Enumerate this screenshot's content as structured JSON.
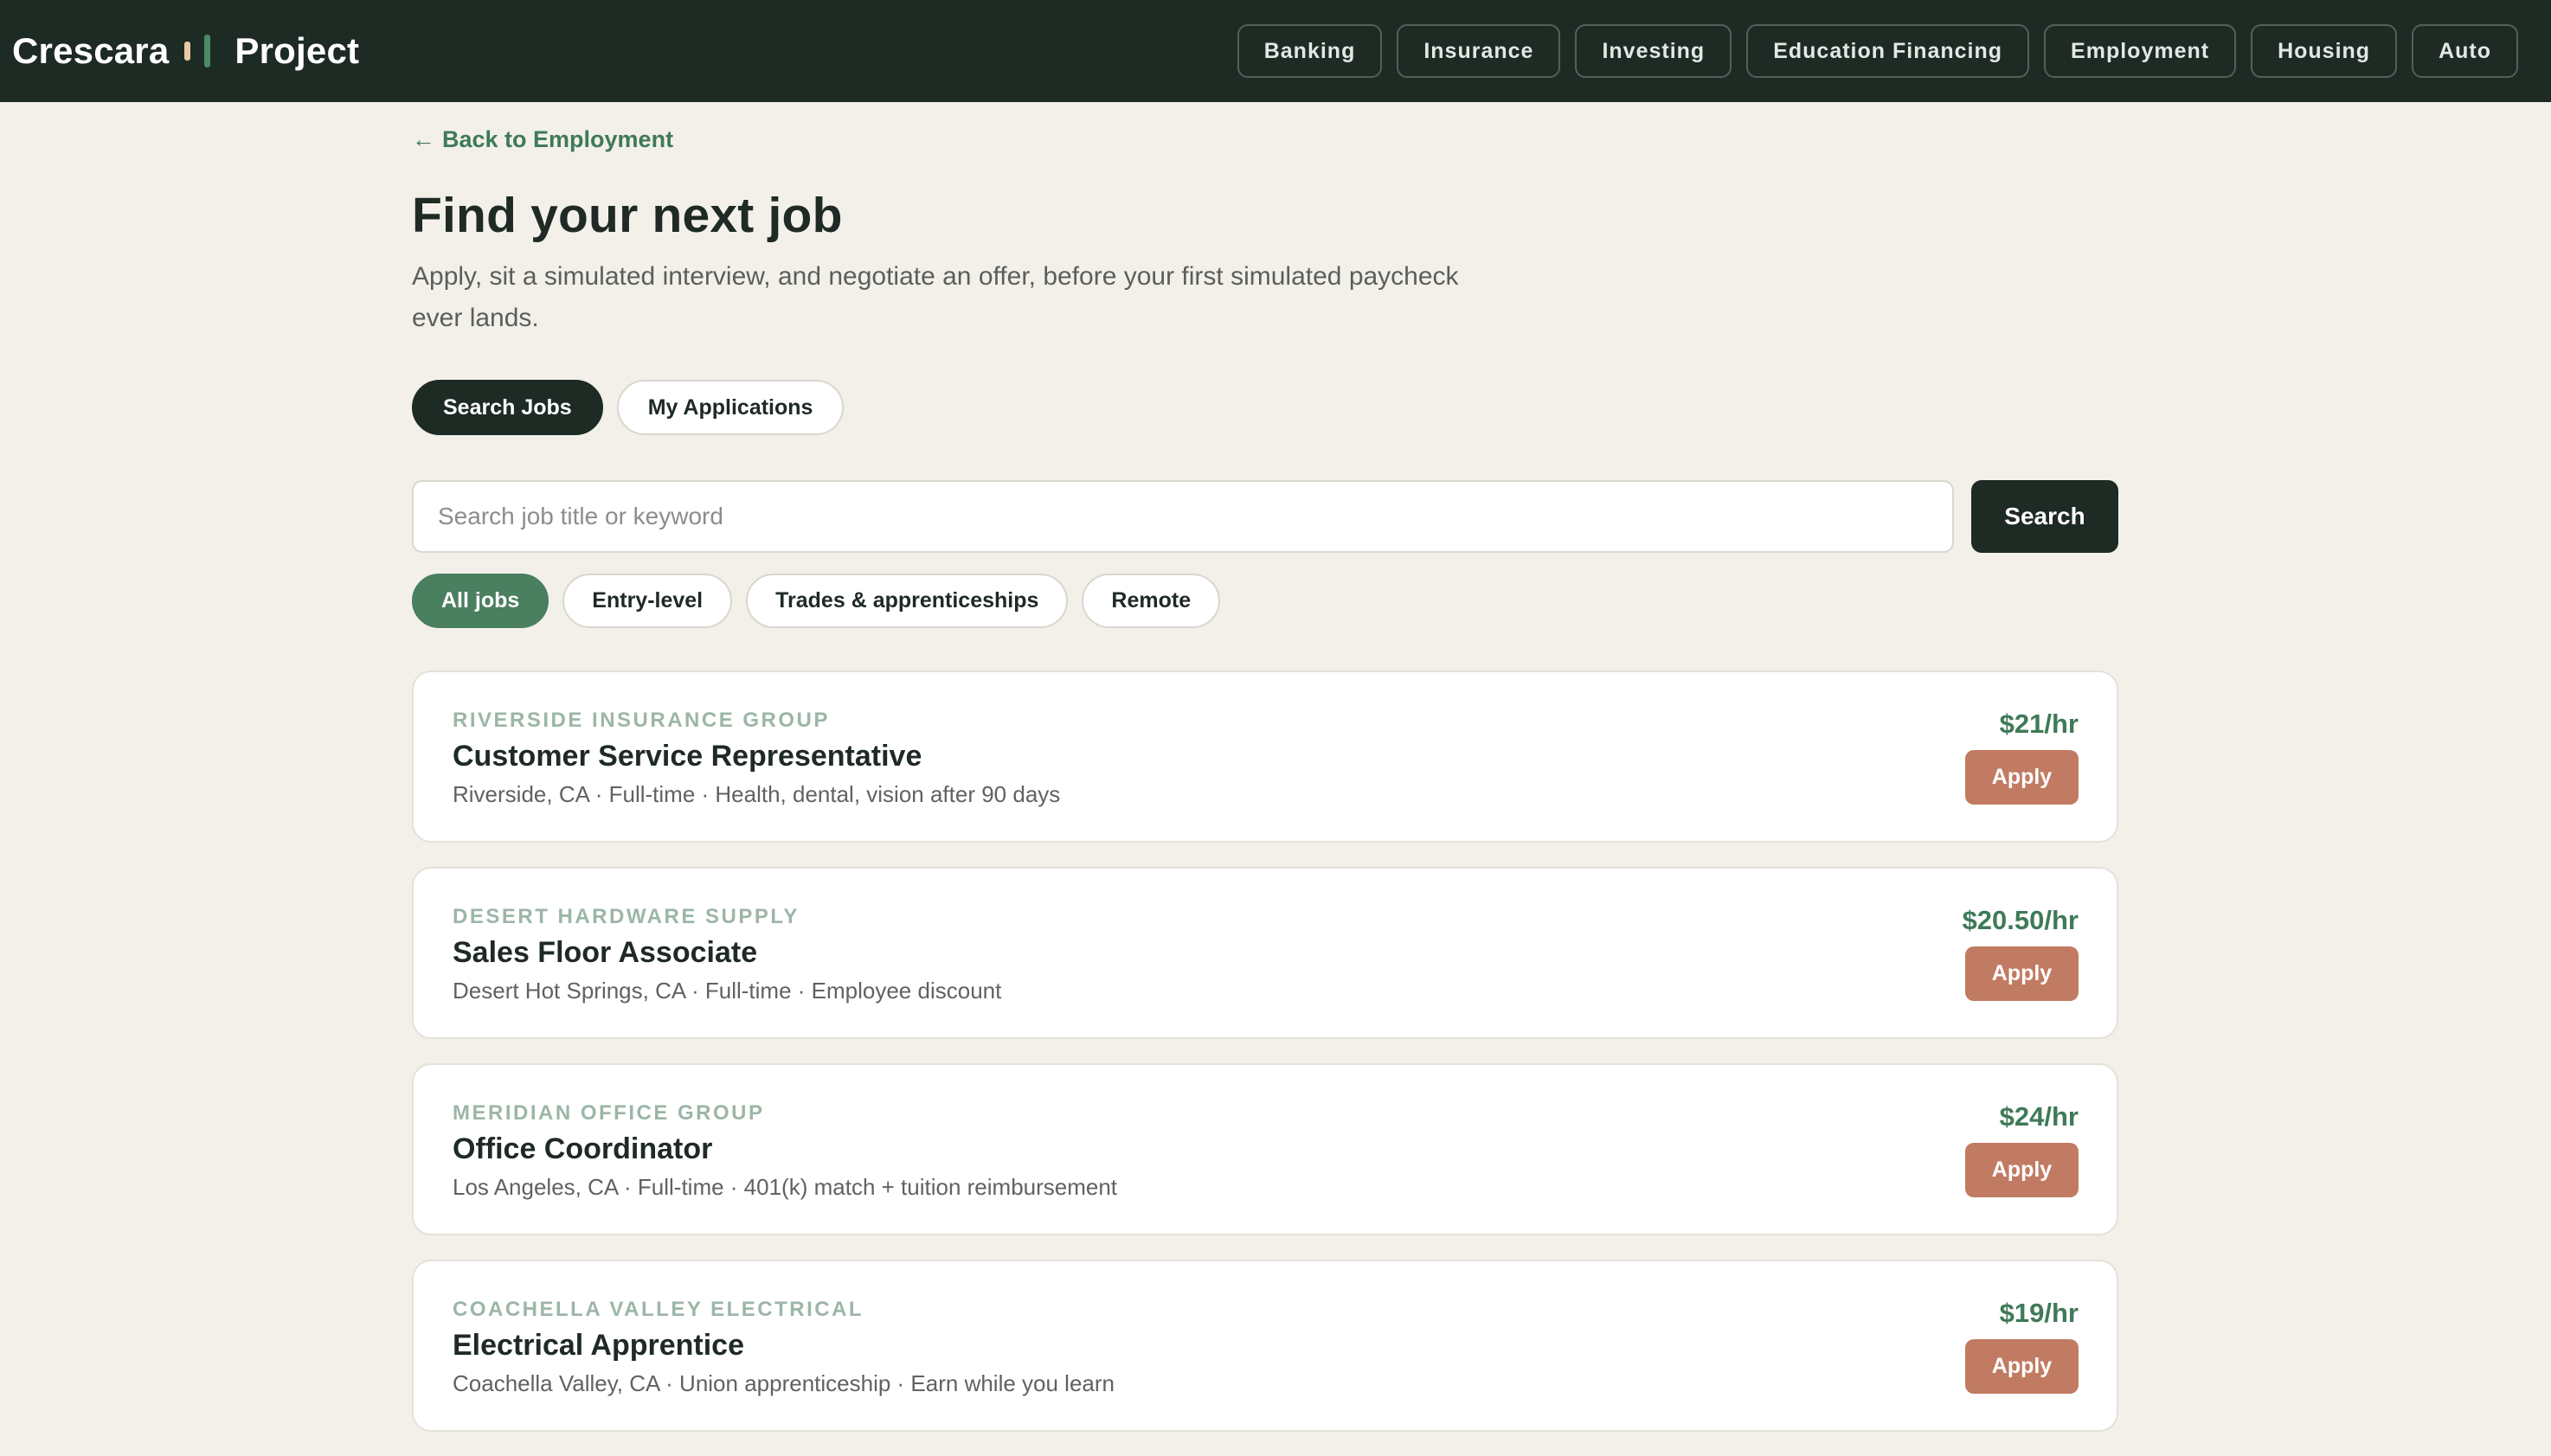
{
  "header": {
    "brand": "Crescara",
    "project": "Project",
    "nav": [
      {
        "label": "Banking"
      },
      {
        "label": "Insurance"
      },
      {
        "label": "Investing"
      },
      {
        "label": "Education Financing"
      },
      {
        "label": "Employment"
      },
      {
        "label": "Housing"
      },
      {
        "label": "Auto"
      }
    ]
  },
  "page": {
    "back_arrow": "←",
    "back_label": "Back to Employment",
    "title": "Find your next job",
    "subtitle": "Apply, sit a simulated interview, and negotiate an offer, before your first simulated paycheck ever lands."
  },
  "tabs": [
    {
      "label": "Search Jobs",
      "active": true
    },
    {
      "label": "My Applications",
      "active": false
    }
  ],
  "search": {
    "placeholder": "Search job title or keyword",
    "value": "",
    "button_label": "Search"
  },
  "filters": [
    {
      "label": "All jobs",
      "active": true
    },
    {
      "label": "Entry-level",
      "active": false
    },
    {
      "label": "Trades & apprenticeships",
      "active": false
    },
    {
      "label": "Remote",
      "active": false
    }
  ],
  "jobs": [
    {
      "company": "RIVERSIDE INSURANCE GROUP",
      "title": "Customer Service Representative",
      "meta": "Riverside, CA · Full-time · Health, dental, vision after 90 days",
      "pay": "$21/hr",
      "apply_label": "Apply"
    },
    {
      "company": "DESERT HARDWARE SUPPLY",
      "title": "Sales Floor Associate",
      "meta": "Desert Hot Springs, CA · Full-time · Employee discount",
      "pay": "$20.50/hr",
      "apply_label": "Apply"
    },
    {
      "company": "MERIDIAN OFFICE GROUP",
      "title": "Office Coordinator",
      "meta": "Los Angeles, CA · Full-time · 401(k) match + tuition reimbursement",
      "pay": "$24/hr",
      "apply_label": "Apply"
    },
    {
      "company": "COACHELLA VALLEY ELECTRICAL",
      "title": "Electrical Apprentice",
      "meta": "Coachella Valley, CA · Union apprenticeship · Earn while you learn",
      "pay": "$19/hr",
      "apply_label": "Apply"
    }
  ],
  "colors": {
    "topbar": "#1e2a24",
    "background": "#f3f0ea",
    "accent_green": "#4a7f5f",
    "pay_green": "#3f7a58",
    "apply_button": "#c17b62"
  }
}
